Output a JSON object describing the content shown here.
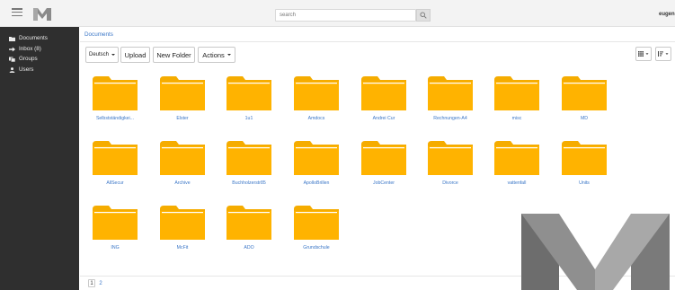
{
  "topbar": {
    "search_placeholder": "search",
    "user_name": "eugen"
  },
  "sidebar": {
    "items": [
      {
        "label": "Documents",
        "icon": "folder-icon"
      },
      {
        "label": "Inbox (8)",
        "icon": "arrow-right-icon"
      },
      {
        "label": "Groups",
        "icon": "group-icon"
      },
      {
        "label": "Users",
        "icon": "user-icon"
      }
    ]
  },
  "breadcrumb": {
    "current": "Documents"
  },
  "toolbar": {
    "language": "Deutsch",
    "upload": "Upload",
    "new_folder": "New Folder",
    "actions": "Actions"
  },
  "folders": [
    "Selbstständigkei...",
    "Elster",
    "1u1",
    "Amdocs",
    "Andrei Cur",
    "Rechnungen-A4",
    "misc",
    "MD",
    "AllSecur",
    "Archive",
    "Buchholzerstr85",
    "ApolloBrillen",
    "JobCenter",
    "Divorce",
    "vattenfall",
    "Units",
    "ING",
    "McFit",
    "ADO",
    "Grundschule"
  ],
  "pagination": {
    "pages": [
      "1",
      "2"
    ],
    "current": "1"
  },
  "colors": {
    "folder": "#ffb300",
    "folder_tab": "#f5ac00",
    "link": "#3a76c7",
    "sidebar_bg": "#2f2f2f"
  }
}
